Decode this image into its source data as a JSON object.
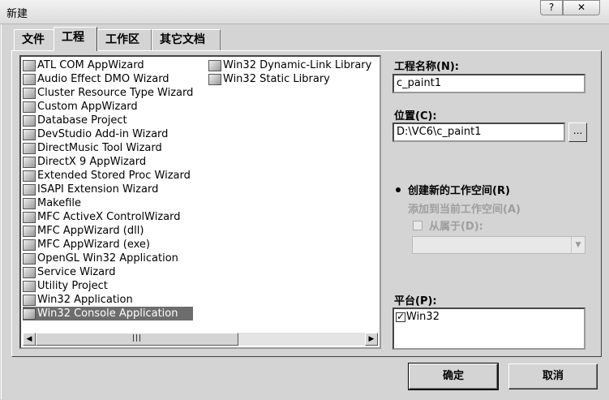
{
  "window": {
    "title": "新建",
    "help_glyph": "?",
    "close_glyph": "✕"
  },
  "tabs": [
    {
      "label": "文件"
    },
    {
      "label": "工程"
    },
    {
      "label": "工作区"
    },
    {
      "label": "其它文档"
    }
  ],
  "wizards_col1": [
    {
      "label": "ATL COM AppWizard",
      "icon": "atl-icon"
    },
    {
      "label": "Audio Effect DMO Wizard",
      "icon": "audio-icon"
    },
    {
      "label": "Cluster Resource Type Wizard",
      "icon": "cluster-icon"
    },
    {
      "label": "Custom AppWizard",
      "icon": "custom-icon"
    },
    {
      "label": "Database Project",
      "icon": "database-icon"
    },
    {
      "label": "DevStudio Add-in Wizard",
      "icon": "addin-icon"
    },
    {
      "label": "DirectMusic Tool Wizard",
      "icon": "music-icon"
    },
    {
      "label": "DirectX 9 AppWizard",
      "icon": "directx-icon"
    },
    {
      "label": "Extended Stored Proc Wizard",
      "icon": "proc-icon"
    },
    {
      "label": "ISAPI Extension Wizard",
      "icon": "isapi-icon"
    },
    {
      "label": "Makefile",
      "icon": "makefile-icon"
    },
    {
      "label": "MFC ActiveX ControlWizard",
      "icon": "activex-icon"
    },
    {
      "label": "MFC AppWizard (dll)",
      "icon": "mfc-dll-icon"
    },
    {
      "label": "MFC AppWizard (exe)",
      "icon": "mfc-exe-icon"
    },
    {
      "label": "OpenGL Win32 Application",
      "icon": "opengl-icon"
    },
    {
      "label": "Service Wizard",
      "icon": "service-icon"
    },
    {
      "label": "Utility Project",
      "icon": "utility-icon"
    },
    {
      "label": "Win32 Application",
      "icon": "win32-app-icon"
    },
    {
      "label": "Win32 Console Application",
      "icon": "console-icon",
      "selected": true
    }
  ],
  "wizards_col2": [
    {
      "label": "Win32 Dynamic-Link Library",
      "icon": "dll-icon"
    },
    {
      "label": "Win32 Static Library",
      "icon": "lib-icon"
    }
  ],
  "project_name": {
    "label": "工程名称(N):",
    "value": "c_paint1"
  },
  "location": {
    "label": "位置(C):",
    "value": "D:\\VC6\\c_paint1",
    "browse_label": "..."
  },
  "workspace": {
    "create_new_label": "创建新的工作空间(R)",
    "add_to_current_label": "添加到当前工作空间(A)",
    "dependency_label": "从属于(D):",
    "selected": "create_new"
  },
  "platform": {
    "label": "平台(P):",
    "items": [
      {
        "label": "Win32",
        "checked": true
      }
    ]
  },
  "buttons": {
    "ok": "确定",
    "cancel": "取消"
  },
  "scrollbar": {
    "grip": "|||"
  }
}
